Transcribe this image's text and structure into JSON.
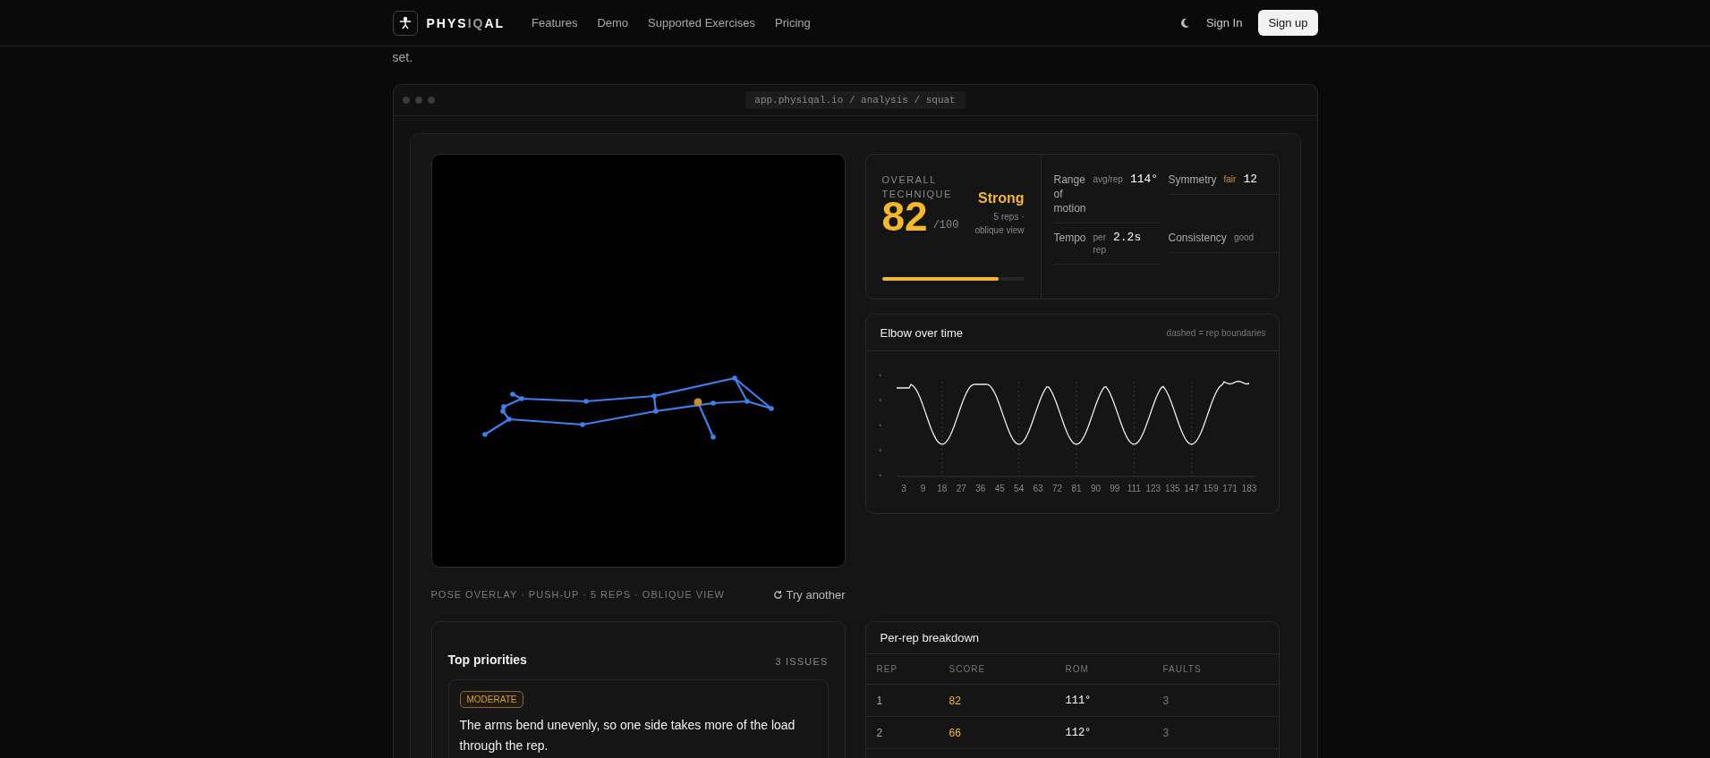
{
  "nav": {
    "brand": [
      {
        "text": "PHYS",
        "dim": false
      },
      {
        "text": "IQ",
        "dim": true
      },
      {
        "text": "AL",
        "dim": false
      }
    ],
    "links": [
      {
        "label": "Features"
      },
      {
        "label": "Demo"
      },
      {
        "label": "Supported Exercises"
      },
      {
        "label": "Pricing"
      }
    ],
    "sign_in": "Sign In",
    "sign_up": "Sign up"
  },
  "intro_tail": "set.",
  "browser": {
    "url": "app.physiqal.io / analysis / squat"
  },
  "pose": {
    "caption": "POSE OVERLAY · PUSH-UP · 5 REPS · OBLIQUE VIEW",
    "action": "Try another"
  },
  "score": {
    "eyebrow": "OVERALL TECHNIQUE",
    "value": "82",
    "out_of": "/100",
    "grade": "Strong",
    "detail": "5 reps · oblique view",
    "level": 0.82
  },
  "metrics": [
    {
      "label": "Range of motion",
      "note": "avg/rep",
      "value": "114°",
      "warning": false
    },
    {
      "label": "Symmetry",
      "note": "fair",
      "value": "12",
      "warning": true
    },
    {
      "label": "Tempo",
      "note": "per rep",
      "value": "2.2s",
      "warning": false
    },
    {
      "label": "Consistency",
      "note": "good",
      "warning": false
    }
  ],
  "elbow_chart": {
    "title": "Elbow over time",
    "legend": "dashed = rep boundaries",
    "y_labels": [
      "°",
      "°",
      "°",
      "°",
      "°"
    ],
    "x_labels": [
      "3",
      "9",
      "18",
      "27",
      "36",
      "45",
      "54",
      "63",
      "72",
      "81",
      "90",
      "99",
      "111",
      "123",
      "135",
      "147",
      "159",
      "171",
      "183"
    ]
  },
  "priorities": {
    "title": "Top priorities",
    "count": "3 ISSUES",
    "items": [
      {
        "severity": "MODERATE",
        "text": "The arms bend unevenly, so one side takes more of the load through the rep."
      }
    ]
  },
  "breakdown": {
    "title": "Per-rep breakdown",
    "columns": [
      "REP",
      "SCORE",
      "ROM",
      "FAULTS"
    ],
    "rows": [
      {
        "rep": "1",
        "score": "82",
        "rom": "111°",
        "faults": "3"
      },
      {
        "rep": "2",
        "score": "66",
        "rom": "112°",
        "faults": "3"
      }
    ]
  }
}
